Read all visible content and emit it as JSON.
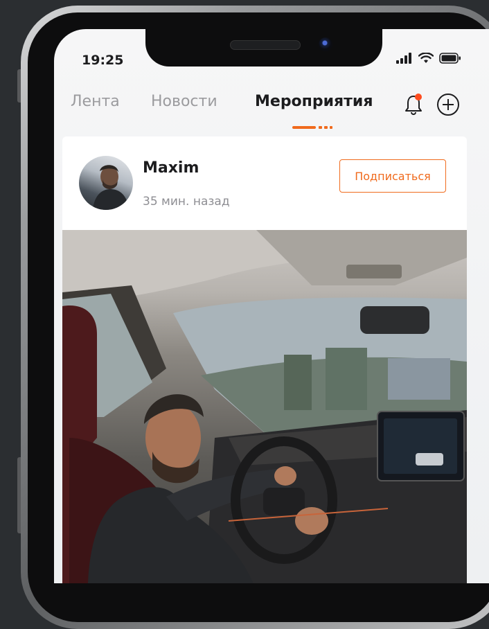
{
  "status_bar": {
    "time": "19:25"
  },
  "tabs": [
    {
      "label": "Лента"
    },
    {
      "label": "Новости"
    },
    {
      "label": "Мероприятия"
    }
  ],
  "post": {
    "author": "Maxim",
    "time_ago": "35 мин. назад",
    "follow_label": "Подписаться"
  },
  "colors": {
    "accent": "#f06a1c",
    "notification_dot": "#ff4d1f"
  },
  "icons": [
    "signal-icon",
    "wifi-icon",
    "battery-icon",
    "bell-icon",
    "add-circle-icon"
  ]
}
